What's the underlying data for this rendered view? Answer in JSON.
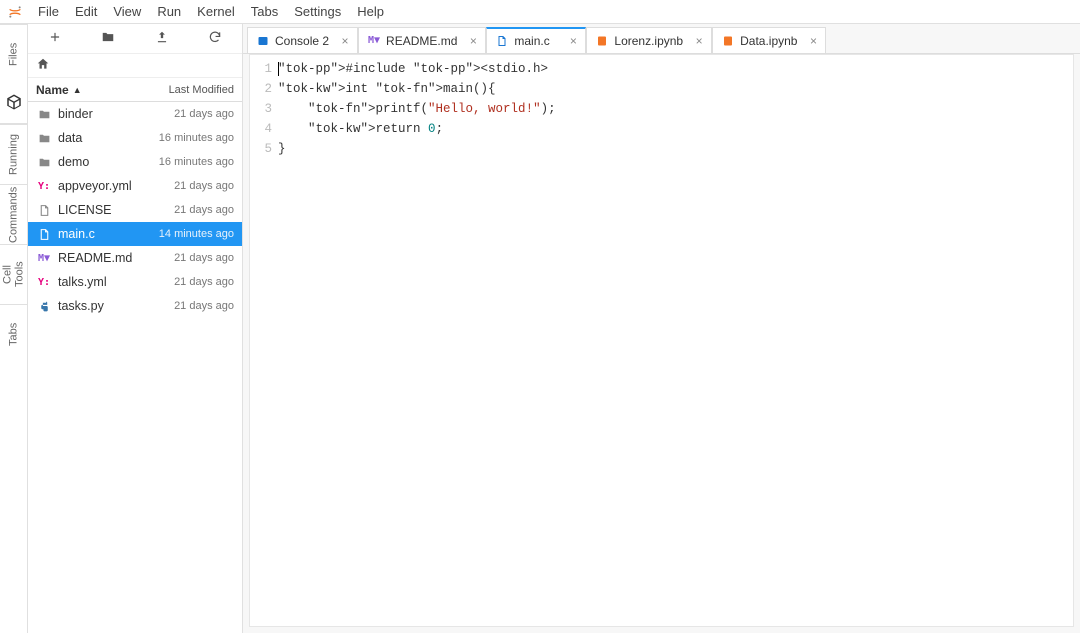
{
  "menu": {
    "items": [
      "File",
      "Edit",
      "View",
      "Run",
      "Kernel",
      "Tabs",
      "Settings",
      "Help"
    ]
  },
  "activity": {
    "tabs": [
      "Files",
      "",
      "Running",
      "Commands",
      "Cell Tools",
      "Tabs"
    ]
  },
  "fileBrowser": {
    "header": {
      "name": "Name",
      "modified": "Last Modified"
    },
    "items": [
      {
        "name": "binder",
        "type": "folder",
        "modified": "21 days ago",
        "selected": false
      },
      {
        "name": "data",
        "type": "folder",
        "modified": "16 minutes ago",
        "selected": false
      },
      {
        "name": "demo",
        "type": "folder",
        "modified": "16 minutes ago",
        "selected": false
      },
      {
        "name": "appveyor.yml",
        "type": "yml",
        "modified": "21 days ago",
        "selected": false
      },
      {
        "name": "LICENSE",
        "type": "file",
        "modified": "21 days ago",
        "selected": false
      },
      {
        "name": "main.c",
        "type": "file",
        "modified": "14 minutes ago",
        "selected": true
      },
      {
        "name": "README.md",
        "type": "md",
        "modified": "21 days ago",
        "selected": false
      },
      {
        "name": "talks.yml",
        "type": "yml",
        "modified": "21 days ago",
        "selected": false
      },
      {
        "name": "tasks.py",
        "type": "py",
        "modified": "21 days ago",
        "selected": false
      }
    ]
  },
  "tabs": [
    {
      "label": "Console 2",
      "type": "console",
      "active": false
    },
    {
      "label": "README.md",
      "type": "md",
      "active": false
    },
    {
      "label": "main.c",
      "type": "file",
      "active": true
    },
    {
      "label": "Lorenz.ipynb",
      "type": "notebook",
      "active": false
    },
    {
      "label": "Data.ipynb",
      "type": "notebook",
      "active": false
    }
  ],
  "editor": {
    "lines": [
      "#include <stdio.h>",
      "int main(){",
      "    printf(\"Hello, world!\");",
      "    return 0;",
      "}"
    ]
  }
}
